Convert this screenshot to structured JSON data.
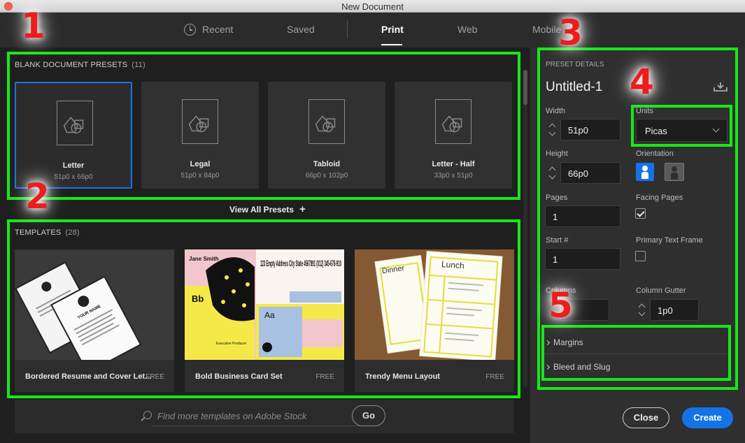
{
  "window": {
    "title": "New Document"
  },
  "tabs": [
    {
      "label": "Recent"
    },
    {
      "label": "Saved"
    },
    {
      "label": "Print"
    },
    {
      "label": "Web"
    },
    {
      "label": "Mobile"
    }
  ],
  "presets": {
    "heading": "BLANK DOCUMENT PRESETS",
    "count": "(11)",
    "items": [
      {
        "name": "Letter",
        "size": "51p0 x 66p0"
      },
      {
        "name": "Legal",
        "size": "51p0 x 84p0"
      },
      {
        "name": "Tabloid",
        "size": "66p0 x 102p0"
      },
      {
        "name": "Letter - Half",
        "size": "33p0 x 51p0"
      }
    ],
    "view_all": "View All Presets",
    "view_all_icon": "+"
  },
  "templates": {
    "heading": "TEMPLATES",
    "count": "(28)",
    "items": [
      {
        "name": "Bordered Resume and Cover Let...",
        "badge": "FREE",
        "thumb_text": "YOUR NAME"
      },
      {
        "name": "Bold Business Card Set",
        "badge": "FREE",
        "thumb_name": "Jane Smith",
        "thumb_address": "123 Empty Address City State 4567891 (012) 345-678-910",
        "thumb_bb": "Bb",
        "thumb_aa": "Aa",
        "thumb_role": "Executive Producer"
      },
      {
        "name": "Trendy Menu Layout",
        "badge": "FREE",
        "thumb_dinner": "Dinner",
        "thumb_lunch": "Lunch"
      }
    ]
  },
  "search": {
    "placeholder": "Find more templates on Adobe Stock",
    "go_label": "Go"
  },
  "details": {
    "heading": "PRESET DETAILS",
    "doc_name": "Untitled-1",
    "width_label": "Width",
    "width_value": "51p0",
    "units_label": "Units",
    "units_value": "Picas",
    "height_label": "Height",
    "height_value": "66p0",
    "orientation_label": "Orientation",
    "pages_label": "Pages",
    "pages_value": "1",
    "facing_label": "Facing Pages",
    "start_label": "Start #",
    "start_value": "1",
    "primary_label": "Primary Text Frame",
    "columns_label": "Columns",
    "gutter_label": "Column Gutter",
    "gutter_value": "1p0",
    "margins_label": "Margins",
    "bleed_label": "Bleed and Slug"
  },
  "footer": {
    "close_label": "Close",
    "create_label": "Create"
  },
  "annotations": [
    "1",
    "2",
    "3",
    "4",
    "5"
  ],
  "colors": {
    "accent": "#1473e6",
    "annotation_box": "#17e817",
    "annotation_number": "#ee1c1c"
  }
}
